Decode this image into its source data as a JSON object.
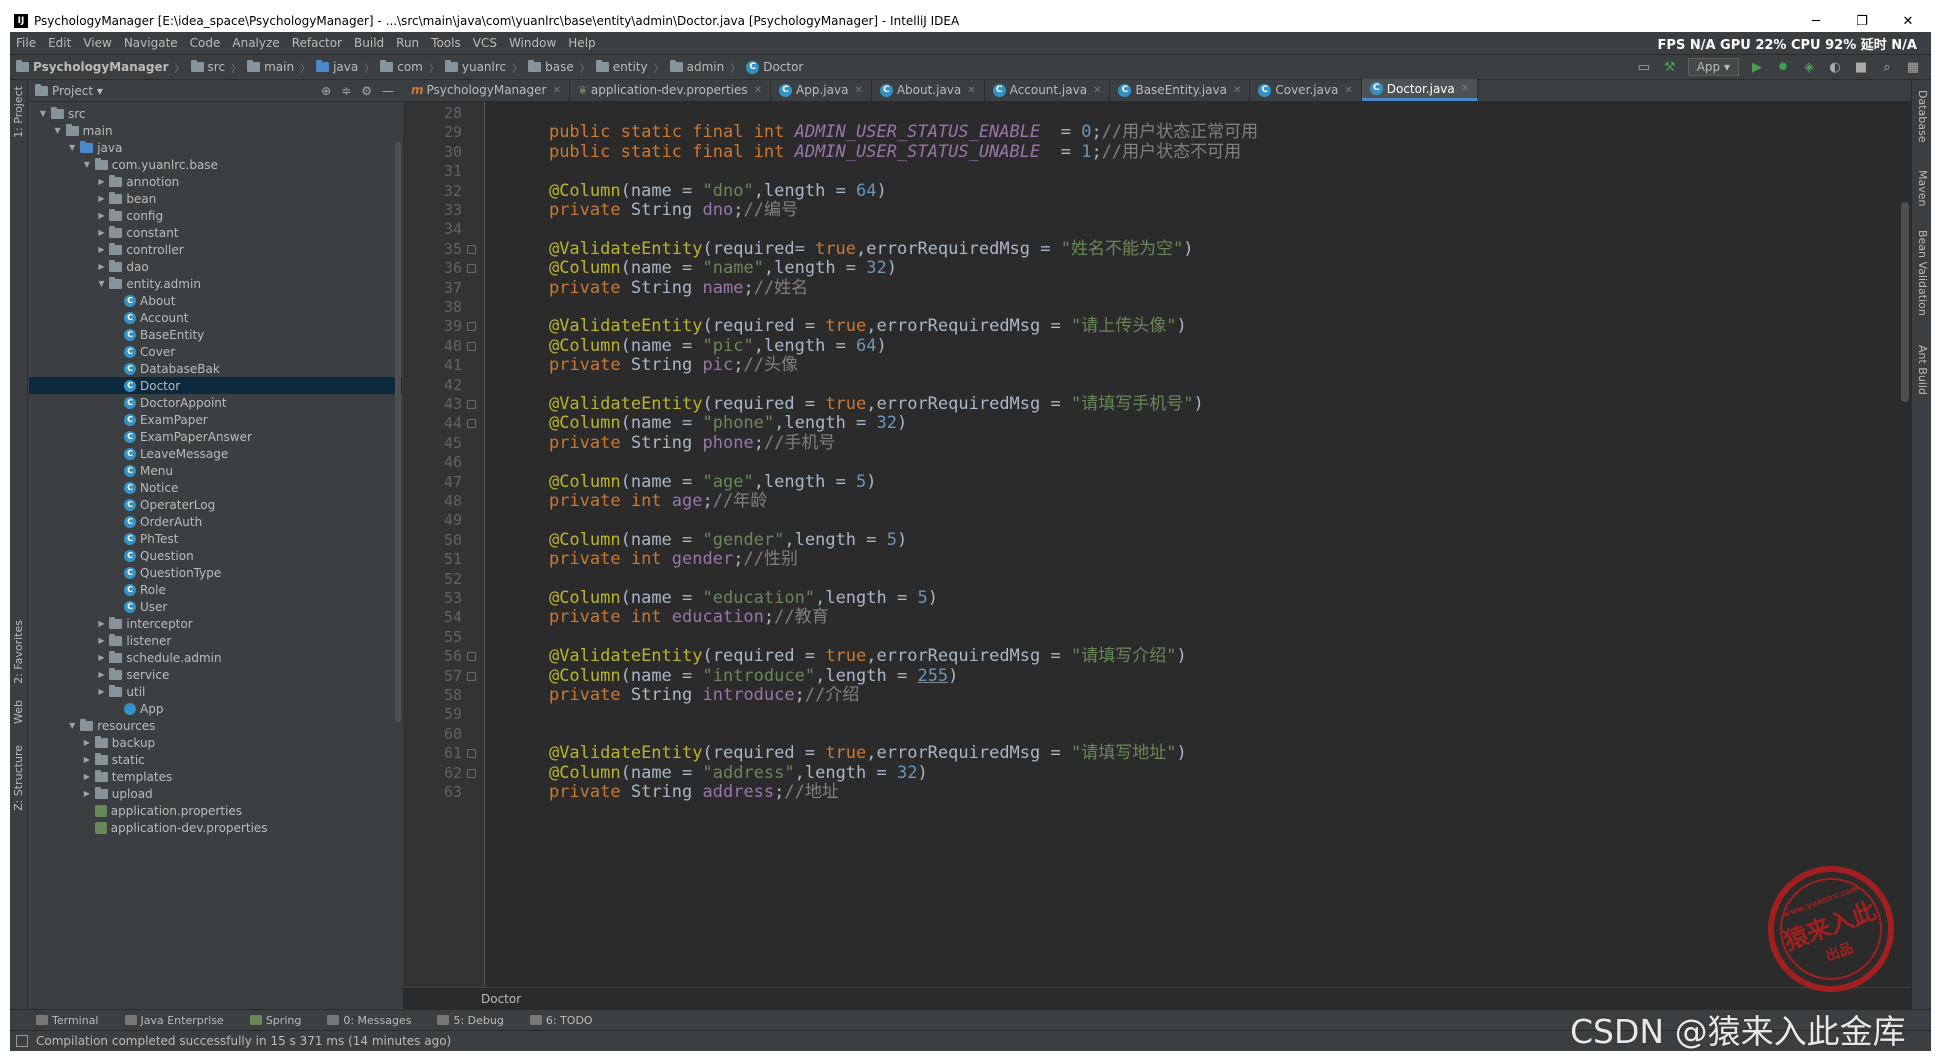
{
  "window": {
    "title": "PsychologyManager [E:\\idea_space\\PsychologyManager] - ...\\src\\main\\java\\com\\yuanlrc\\base\\entity\\admin\\Doctor.java [PsychologyManager] - IntelliJ IDEA",
    "app_icon": "IJ",
    "minimize": "─",
    "maximize": "❐",
    "close": "✕"
  },
  "menu": [
    "File",
    "Edit",
    "View",
    "Navigate",
    "Code",
    "Analyze",
    "Refactor",
    "Build",
    "Run",
    "Tools",
    "VCS",
    "Window",
    "Help"
  ],
  "perf": "FPS N/A GPU 22% CPU 92% 延时 N/A",
  "breadcrumb": {
    "project": "PsychologyManager",
    "items": [
      "src",
      "main",
      "java",
      "com",
      "yuanlrc",
      "base",
      "entity",
      "admin"
    ],
    "file": "Doctor"
  },
  "run_config": "App ▾",
  "left_stripe": {
    "project": "1: Project",
    "favorites": "2: Favorites",
    "web": "Web",
    "structure": "Z: Structure"
  },
  "right_stripe": {
    "database": "Database",
    "maven": "Maven",
    "bean_validation": "Bean Validation",
    "ant_build": "Ant Build"
  },
  "project_panel": {
    "title": "Project ▾",
    "tree": [
      {
        "label": "src",
        "depth": 1,
        "type": "folder",
        "open": true
      },
      {
        "label": "main",
        "depth": 2,
        "type": "folder",
        "open": true
      },
      {
        "label": "java",
        "depth": 3,
        "type": "bluefolder",
        "open": true
      },
      {
        "label": "com.yuanlrc.base",
        "depth": 4,
        "type": "folder",
        "open": true
      },
      {
        "label": "annotion",
        "depth": 5,
        "type": "folder",
        "open": false
      },
      {
        "label": "bean",
        "depth": 5,
        "type": "folder",
        "open": false
      },
      {
        "label": "config",
        "depth": 5,
        "type": "folder",
        "open": false
      },
      {
        "label": "constant",
        "depth": 5,
        "type": "folder",
        "open": false
      },
      {
        "label": "controller",
        "depth": 5,
        "type": "folder",
        "open": false
      },
      {
        "label": "dao",
        "depth": 5,
        "type": "folder",
        "open": false
      },
      {
        "label": "entity.admin",
        "depth": 5,
        "type": "folder",
        "open": true
      },
      {
        "label": "About",
        "depth": 6,
        "type": "class"
      },
      {
        "label": "Account",
        "depth": 6,
        "type": "class"
      },
      {
        "label": "BaseEntity",
        "depth": 6,
        "type": "class"
      },
      {
        "label": "Cover",
        "depth": 6,
        "type": "class"
      },
      {
        "label": "DatabaseBak",
        "depth": 6,
        "type": "class"
      },
      {
        "label": "Doctor",
        "depth": 6,
        "type": "class",
        "selected": true
      },
      {
        "label": "DoctorAppoint",
        "depth": 6,
        "type": "class"
      },
      {
        "label": "ExamPaper",
        "depth": 6,
        "type": "class"
      },
      {
        "label": "ExamPaperAnswer",
        "depth": 6,
        "type": "class"
      },
      {
        "label": "LeaveMessage",
        "depth": 6,
        "type": "class"
      },
      {
        "label": "Menu",
        "depth": 6,
        "type": "class"
      },
      {
        "label": "Notice",
        "depth": 6,
        "type": "class"
      },
      {
        "label": "OperaterLog",
        "depth": 6,
        "type": "class"
      },
      {
        "label": "OrderAuth",
        "depth": 6,
        "type": "class"
      },
      {
        "label": "PhTest",
        "depth": 6,
        "type": "class"
      },
      {
        "label": "Question",
        "depth": 6,
        "type": "class"
      },
      {
        "label": "QuestionType",
        "depth": 6,
        "type": "class"
      },
      {
        "label": "Role",
        "depth": 6,
        "type": "class"
      },
      {
        "label": "User",
        "depth": 6,
        "type": "class"
      },
      {
        "label": "interceptor",
        "depth": 5,
        "type": "folder",
        "open": false
      },
      {
        "label": "listener",
        "depth": 5,
        "type": "folder",
        "open": false
      },
      {
        "label": "schedule.admin",
        "depth": 5,
        "type": "folder",
        "open": false
      },
      {
        "label": "service",
        "depth": 5,
        "type": "folder",
        "open": false
      },
      {
        "label": "util",
        "depth": 5,
        "type": "folder",
        "open": false
      },
      {
        "label": "App",
        "depth": 6,
        "type": "app"
      },
      {
        "label": "resources",
        "depth": 3,
        "type": "folder",
        "open": true
      },
      {
        "label": "backup",
        "depth": 4,
        "type": "folder",
        "open": false
      },
      {
        "label": "static",
        "depth": 4,
        "type": "folder",
        "open": false
      },
      {
        "label": "templates",
        "depth": 4,
        "type": "folder",
        "open": false
      },
      {
        "label": "upload",
        "depth": 4,
        "type": "folder",
        "open": false
      },
      {
        "label": "application.properties",
        "depth": 4,
        "type": "props"
      },
      {
        "label": "application-dev.properties",
        "depth": 4,
        "type": "props"
      }
    ]
  },
  "editor_tabs": [
    {
      "label": "PsychologyManager",
      "icon": "m"
    },
    {
      "label": "application-dev.properties",
      "icon": "p"
    },
    {
      "label": "App.java",
      "icon": "c"
    },
    {
      "label": "About.java",
      "icon": "c"
    },
    {
      "label": "Account.java",
      "icon": "c"
    },
    {
      "label": "BaseEntity.java",
      "icon": "c"
    },
    {
      "label": "Cover.java",
      "icon": "c"
    },
    {
      "label": "Doctor.java",
      "icon": "c",
      "active": true
    }
  ],
  "code": {
    "first_line": 28,
    "lines": [
      [],
      [
        [
          "kw",
          "public static final int "
        ],
        [
          "cf",
          "ADMIN_USER_STATUS_ENABLE"
        ],
        [
          "",
          "  = "
        ],
        [
          "nm",
          "0"
        ],
        [
          "",
          ";"
        ],
        [
          "cm",
          "//用户状态正常可用"
        ]
      ],
      [
        [
          "kw",
          "public static final int "
        ],
        [
          "cf",
          "ADMIN_USER_STATUS_UNABLE"
        ],
        [
          "",
          "  = "
        ],
        [
          "nm",
          "1"
        ],
        [
          "",
          ";"
        ],
        [
          "cm",
          "//用户状态不可用"
        ]
      ],
      [],
      [
        [
          "an",
          "@Column"
        ],
        [
          "",
          "(name = "
        ],
        [
          "st",
          "\"dno\""
        ],
        [
          "",
          ",length = "
        ],
        [
          "nm",
          "64"
        ],
        [
          "",
          ")"
        ]
      ],
      [
        [
          "kw",
          "private "
        ],
        [
          "",
          "String "
        ],
        [
          "fd",
          "dno"
        ],
        [
          "",
          ";"
        ],
        [
          "cm",
          "//编号"
        ]
      ],
      [],
      [
        [
          "an",
          "@ValidateEntity"
        ],
        [
          "",
          "(required= "
        ],
        [
          "kw",
          "true"
        ],
        [
          "",
          ",errorRequiredMsg = "
        ],
        [
          "st",
          "\"姓名不能为空\""
        ],
        [
          "",
          ")"
        ]
      ],
      [
        [
          "an",
          "@Column"
        ],
        [
          "",
          "(name = "
        ],
        [
          "st",
          "\"name\""
        ],
        [
          "",
          ",length = "
        ],
        [
          "nm",
          "32"
        ],
        [
          "",
          ")"
        ]
      ],
      [
        [
          "kw",
          "private "
        ],
        [
          "",
          "String "
        ],
        [
          "fd",
          "name"
        ],
        [
          "",
          ";"
        ],
        [
          "cm",
          "//姓名"
        ]
      ],
      [],
      [
        [
          "an",
          "@ValidateEntity"
        ],
        [
          "",
          "(required = "
        ],
        [
          "kw",
          "true"
        ],
        [
          "",
          ",errorRequiredMsg = "
        ],
        [
          "st",
          "\"请上传头像\""
        ],
        [
          "",
          ")"
        ]
      ],
      [
        [
          "an",
          "@Column"
        ],
        [
          "",
          "(name = "
        ],
        [
          "st",
          "\"pic\""
        ],
        [
          "",
          ",length = "
        ],
        [
          "nm",
          "64"
        ],
        [
          "",
          ")"
        ]
      ],
      [
        [
          "kw",
          "private "
        ],
        [
          "",
          "String "
        ],
        [
          "fd",
          "pic"
        ],
        [
          "",
          ";"
        ],
        [
          "cm",
          "//头像"
        ]
      ],
      [],
      [
        [
          "an",
          "@ValidateEntity"
        ],
        [
          "",
          "(required = "
        ],
        [
          "kw",
          "true"
        ],
        [
          "",
          ",errorRequiredMsg = "
        ],
        [
          "st",
          "\"请填写手机号\""
        ],
        [
          "",
          ")"
        ]
      ],
      [
        [
          "an",
          "@Column"
        ],
        [
          "",
          "(name = "
        ],
        [
          "st",
          "\"phone\""
        ],
        [
          "",
          ",length = "
        ],
        [
          "nm",
          "32"
        ],
        [
          "",
          ")"
        ]
      ],
      [
        [
          "kw",
          "private "
        ],
        [
          "",
          "String "
        ],
        [
          "fd",
          "phone"
        ],
        [
          "",
          ";"
        ],
        [
          "cm",
          "//手机号"
        ]
      ],
      [],
      [
        [
          "an",
          "@Column"
        ],
        [
          "",
          "(name = "
        ],
        [
          "st",
          "\"age\""
        ],
        [
          "",
          ",length = "
        ],
        [
          "nm",
          "5"
        ],
        [
          "",
          ")"
        ]
      ],
      [
        [
          "kw",
          "private int "
        ],
        [
          "fd",
          "age"
        ],
        [
          "",
          ";"
        ],
        [
          "cm",
          "//年龄"
        ]
      ],
      [],
      [
        [
          "an",
          "@Column"
        ],
        [
          "",
          "(name = "
        ],
        [
          "st",
          "\"gender\""
        ],
        [
          "",
          ",length = "
        ],
        [
          "nm",
          "5"
        ],
        [
          "",
          ")"
        ]
      ],
      [
        [
          "kw",
          "private int "
        ],
        [
          "fd",
          "gender"
        ],
        [
          "",
          ";"
        ],
        [
          "cm",
          "//性别"
        ]
      ],
      [],
      [
        [
          "an",
          "@Column"
        ],
        [
          "",
          "(name = "
        ],
        [
          "st",
          "\"education\""
        ],
        [
          "",
          ",length = "
        ],
        [
          "nm",
          "5"
        ],
        [
          "",
          ")"
        ]
      ],
      [
        [
          "kw",
          "private int "
        ],
        [
          "fd",
          "education"
        ],
        [
          "",
          ";"
        ],
        [
          "cm",
          "//教育"
        ]
      ],
      [],
      [
        [
          "an",
          "@ValidateEntity"
        ],
        [
          "",
          "(required = "
        ],
        [
          "kw",
          "true"
        ],
        [
          "",
          ",errorRequiredMsg = "
        ],
        [
          "st",
          "\"请填写介绍\""
        ],
        [
          "",
          ")"
        ]
      ],
      [
        [
          "an",
          "@Column"
        ],
        [
          "",
          "(name = "
        ],
        [
          "st",
          "\"introduce\""
        ],
        [
          "",
          ",length = "
        ],
        [
          "ul",
          "255"
        ],
        [
          "",
          ")"
        ]
      ],
      [
        [
          "kw",
          "private "
        ],
        [
          "",
          "String "
        ],
        [
          "fd",
          "introduce"
        ],
        [
          "",
          ";"
        ],
        [
          "cm",
          "//介绍"
        ]
      ],
      [],
      [],
      [
        [
          "an",
          "@ValidateEntity"
        ],
        [
          "",
          "(required = "
        ],
        [
          "kw",
          "true"
        ],
        [
          "",
          ",errorRequiredMsg = "
        ],
        [
          "st",
          "\"请填写地址\""
        ],
        [
          "",
          ")"
        ]
      ],
      [
        [
          "an",
          "@Column"
        ],
        [
          "",
          "(name = "
        ],
        [
          "st",
          "\"address\""
        ],
        [
          "",
          ",length = "
        ],
        [
          "nm",
          "32"
        ],
        [
          "",
          ")"
        ]
      ],
      [
        [
          "kw",
          "private "
        ],
        [
          "",
          "String "
        ],
        [
          "fd",
          "address"
        ],
        [
          "",
          ";"
        ],
        [
          "cm",
          "//地址"
        ]
      ]
    ],
    "fold_lines": [
      35,
      36,
      39,
      40,
      43,
      44,
      56,
      57,
      61,
      62
    ]
  },
  "editor_breadcrumb": "Doctor",
  "bottom_tools": [
    "Terminal",
    "Java Enterprise",
    "Spring",
    "0: Messages",
    "5: Debug",
    "6: TODO"
  ],
  "status": "Compilation completed successfully in 15 s 371 ms (14 minutes ago)",
  "watermark": {
    "stamp_url": "www.yuanlrc.com",
    "stamp_main": "猿来入此",
    "stamp_sub": "出品",
    "csdn": "CSDN @猿来入此金库"
  }
}
